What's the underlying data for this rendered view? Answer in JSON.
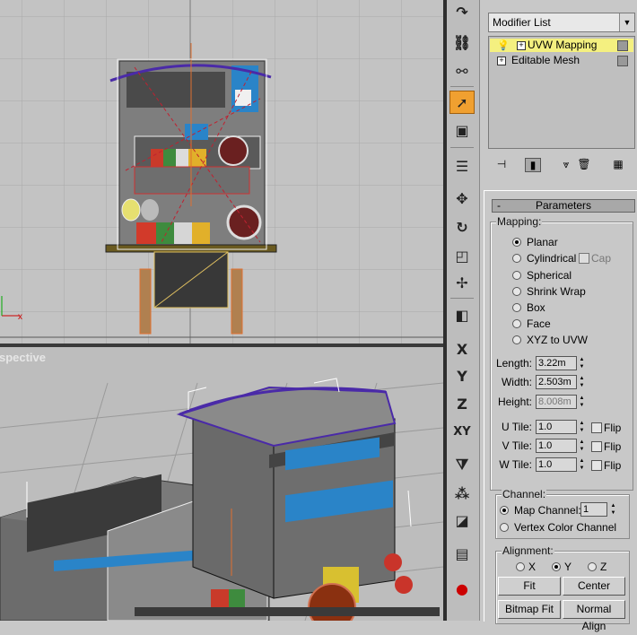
{
  "viewports": {
    "perspective_label": "Perspective"
  },
  "toolbar": {
    "icons": [
      "redo-icon",
      "link-icon",
      "unlink-icon",
      "select-icon",
      "select-region-icon",
      "select-by-name-icon",
      "move-icon",
      "rotate-icon",
      "scale-icon",
      "snap-icon",
      "mirror-icon",
      "x-axis",
      "y-axis",
      "z-axis",
      "xy-axis",
      "mirror-axis-icon",
      "array-icon",
      "align-icon",
      "layer-icon",
      "render-icon"
    ],
    "axis_labels": {
      "x": "X",
      "y": "Y",
      "z": "Z",
      "xy": "XY"
    }
  },
  "panel": {
    "modifier_list": "Modifier List",
    "stack": [
      {
        "label": "UVW Mapping",
        "selected": true
      },
      {
        "label": "Editable Mesh",
        "selected": false
      }
    ],
    "parameters": {
      "header": "Parameters",
      "collapse": "-",
      "mapping_title": "Mapping:",
      "mapping_options": [
        "Planar",
        "Cylindrical",
        "Spherical",
        "Shrink Wrap",
        "Box",
        "Face",
        "XYZ to UVW"
      ],
      "mapping_selected": "Planar",
      "cap_label": "Cap",
      "length_label": "Length:",
      "length_value": "3.22m",
      "width_label": "Width:",
      "width_value": "2.503m",
      "height_label": "Height:",
      "height_value": "8.008m",
      "utile_label": "U Tile:",
      "utile_value": "1.0",
      "vtile_label": "V Tile:",
      "vtile_value": "1.0",
      "wtile_label": "W Tile:",
      "wtile_value": "1.0",
      "flip_label": "Flip"
    },
    "channel": {
      "title": "Channel:",
      "map_channel_label": "Map Channel:",
      "map_channel_value": "1",
      "vertex_color_label": "Vertex Color Channel"
    },
    "alignment": {
      "title": "Alignment:",
      "x": "X",
      "y": "Y",
      "z": "Z",
      "selected": "Y",
      "fit": "Fit",
      "center": "Center",
      "bitmap_fit": "Bitmap Fit",
      "normal_align": "Normal Align"
    }
  },
  "colors": {
    "active_tool": "#f0a030",
    "selected_modifier": "#f4f080",
    "viewport_bg": "#c3c3c3"
  }
}
